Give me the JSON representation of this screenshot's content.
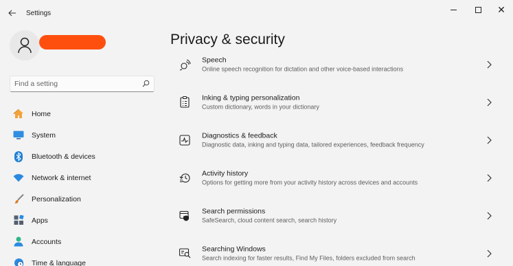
{
  "window": {
    "title": "Settings"
  },
  "sidebar": {
    "search": {
      "placeholder": "Find a setting",
      "value": ""
    },
    "items": [
      {
        "label": "Home",
        "icon": "home-icon"
      },
      {
        "label": "System",
        "icon": "system-icon"
      },
      {
        "label": "Bluetooth & devices",
        "icon": "bluetooth-icon"
      },
      {
        "label": "Network & internet",
        "icon": "wifi-icon"
      },
      {
        "label": "Personalization",
        "icon": "brush-icon"
      },
      {
        "label": "Apps",
        "icon": "apps-icon"
      },
      {
        "label": "Accounts",
        "icon": "accounts-icon"
      },
      {
        "label": "Time & language",
        "icon": "globe-clock-icon"
      }
    ]
  },
  "main": {
    "title": "Privacy & security",
    "rows": [
      {
        "title": "Speech",
        "desc": "Online speech recognition for dictation and other voice-based interactions",
        "icon": "speech-icon"
      },
      {
        "title": "Inking & typing personalization",
        "desc": "Custom dictionary, words in your dictionary",
        "icon": "clipboard-list-icon"
      },
      {
        "title": "Diagnostics & feedback",
        "desc": "Diagnostic data, inking and typing data, tailored experiences, feedback frequency",
        "icon": "diagnostics-icon"
      },
      {
        "title": "Activity history",
        "desc": "Options for getting more from your activity history across devices and accounts",
        "icon": "history-icon"
      },
      {
        "title": "Search permissions",
        "desc": "SafeSearch, cloud content search, search history",
        "icon": "search-permissions-icon"
      },
      {
        "title": "Searching Windows",
        "desc": "Search indexing for faster results, Find My Files, folders excluded from search",
        "icon": "searching-windows-icon"
      }
    ]
  },
  "colors": {
    "background": "#f3f3f3",
    "redaction": "#ff4f0f",
    "accent": "#0067c0"
  }
}
